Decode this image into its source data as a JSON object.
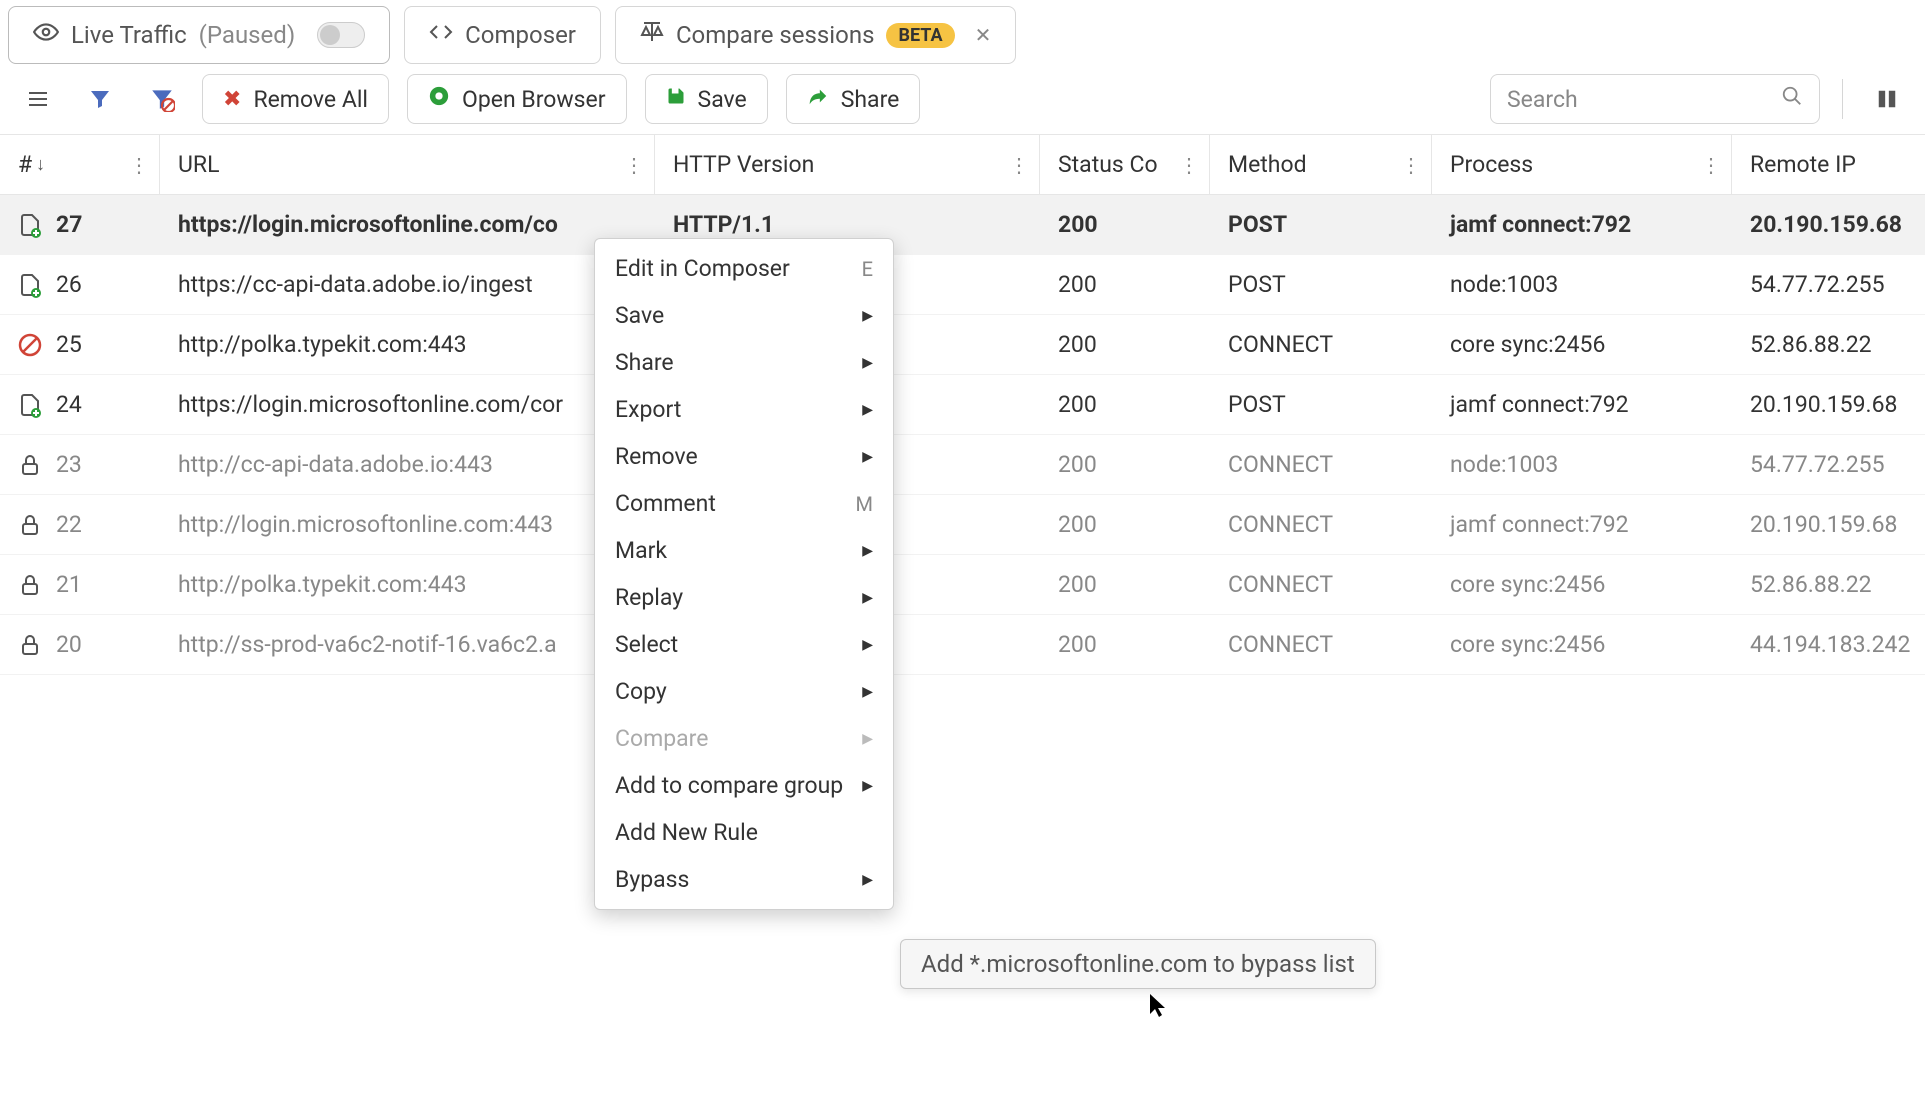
{
  "tabs": {
    "live": {
      "label": "Live Traffic",
      "paused": "(Paused)"
    },
    "composer": {
      "label": "Composer"
    },
    "compare": {
      "label": "Compare sessions",
      "beta": "BETA"
    }
  },
  "toolbar": {
    "remove_all": "Remove All",
    "open_browser": "Open Browser",
    "save": "Save",
    "share": "Share",
    "search_placeholder": "Search"
  },
  "columns": {
    "num": "#",
    "url": "URL",
    "http": "HTTP Version",
    "status": "Status Co",
    "method": "Method",
    "process": "Process",
    "ip": "Remote IP"
  },
  "rows": [
    {
      "n": "27",
      "url": "https://login.microsoftonline.com/co",
      "http": "HTTP/1.1",
      "status": "200",
      "method": "POST",
      "process": "jamf connect:792",
      "ip": "20.190.159.68",
      "icon": "doc-green",
      "bold": true,
      "muted": false
    },
    {
      "n": "26",
      "url": "https://cc-api-data.adobe.io/ingest",
      "http": "",
      "status": "200",
      "method": "POST",
      "process": "node:1003",
      "ip": "54.77.72.255",
      "icon": "doc-green",
      "bold": false,
      "muted": false
    },
    {
      "n": "25",
      "url": "http://polka.typekit.com:443",
      "http": "",
      "status": "200",
      "method": "CONNECT",
      "process": "core sync:2456",
      "ip": "52.86.88.22",
      "icon": "blocked",
      "bold": false,
      "muted": false
    },
    {
      "n": "24",
      "url": "https://login.microsoftonline.com/cor",
      "http": "",
      "status": "200",
      "method": "POST",
      "process": "jamf connect:792",
      "ip": "20.190.159.68",
      "icon": "doc-green",
      "bold": false,
      "muted": false
    },
    {
      "n": "23",
      "url": "http://cc-api-data.adobe.io:443",
      "http": "",
      "status": "200",
      "method": "CONNECT",
      "process": "node:1003",
      "ip": "54.77.72.255",
      "icon": "lock",
      "bold": false,
      "muted": true
    },
    {
      "n": "22",
      "url": "http://login.microsoftonline.com:443",
      "http": "",
      "status": "200",
      "method": "CONNECT",
      "process": "jamf connect:792",
      "ip": "20.190.159.68",
      "icon": "lock",
      "bold": false,
      "muted": true
    },
    {
      "n": "21",
      "url": "http://polka.typekit.com:443",
      "http": "",
      "status": "200",
      "method": "CONNECT",
      "process": "core sync:2456",
      "ip": "52.86.88.22",
      "icon": "lock",
      "bold": false,
      "muted": true
    },
    {
      "n": "20",
      "url": "http://ss-prod-va6c2-notif-16.va6c2.a",
      "http": "",
      "status": "200",
      "method": "CONNECT",
      "process": "core sync:2456",
      "ip": "44.194.183.242",
      "icon": "lock",
      "bold": false,
      "muted": true
    }
  ],
  "context_menu": {
    "items": [
      {
        "label": "Edit in Composer",
        "shortcut": "E",
        "sub": false,
        "disabled": false
      },
      {
        "label": "Save",
        "shortcut": "",
        "sub": true,
        "disabled": false
      },
      {
        "label": "Share",
        "shortcut": "",
        "sub": true,
        "disabled": false
      },
      {
        "label": "Export",
        "shortcut": "",
        "sub": true,
        "disabled": false
      },
      {
        "label": "Remove",
        "shortcut": "",
        "sub": true,
        "disabled": false
      },
      {
        "label": "Comment",
        "shortcut": "M",
        "sub": false,
        "disabled": false
      },
      {
        "label": "Mark",
        "shortcut": "",
        "sub": true,
        "disabled": false
      },
      {
        "label": "Replay",
        "shortcut": "",
        "sub": true,
        "disabled": false
      },
      {
        "label": "Select",
        "shortcut": "",
        "sub": true,
        "disabled": false
      },
      {
        "label": "Copy",
        "shortcut": "",
        "sub": true,
        "disabled": false
      },
      {
        "label": "Compare",
        "shortcut": "",
        "sub": true,
        "disabled": true
      },
      {
        "label": "Add to compare group",
        "shortcut": "",
        "sub": true,
        "disabled": false
      },
      {
        "label": "Add New Rule",
        "shortcut": "",
        "sub": false,
        "disabled": false
      },
      {
        "label": "Bypass",
        "shortcut": "",
        "sub": true,
        "disabled": false
      }
    ],
    "submenu": "Add *.microsoftonline.com to bypass list"
  }
}
